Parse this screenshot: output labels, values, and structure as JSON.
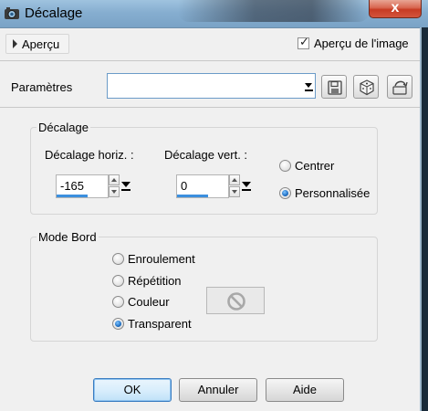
{
  "window": {
    "title": "Décalage",
    "close_glyph": "x"
  },
  "preview": {
    "apercu_label": "Aperçu",
    "image_preview_label": "Aperçu de l'image",
    "image_preview_checked": true
  },
  "params": {
    "label": "Paramètres",
    "preset_value": "",
    "tools": [
      "save-preset-icon",
      "random-dice-icon",
      "reset-preset-icon"
    ]
  },
  "offset_group": {
    "title": "Décalage",
    "horiz_label": "Décalage horiz. :",
    "horiz_value": "-165",
    "vert_label": "Décalage vert. :",
    "vert_value": "0",
    "options": [
      {
        "label": "Centrer",
        "selected": false
      },
      {
        "label": "Personnalisée",
        "selected": true
      }
    ]
  },
  "edge_group": {
    "title": "Mode Bord",
    "options": [
      {
        "label": "Enroulement",
        "selected": false
      },
      {
        "label": "Répétition",
        "selected": false
      },
      {
        "label": "Couleur",
        "selected": false
      },
      {
        "label": "Transparent",
        "selected": true
      }
    ]
  },
  "buttons": {
    "ok": "OK",
    "cancel": "Annuler",
    "help": "Aide"
  },
  "colors": {
    "accent": "#3c8fde",
    "close_red": "#c73b23",
    "title_blue": "#86aed0"
  }
}
